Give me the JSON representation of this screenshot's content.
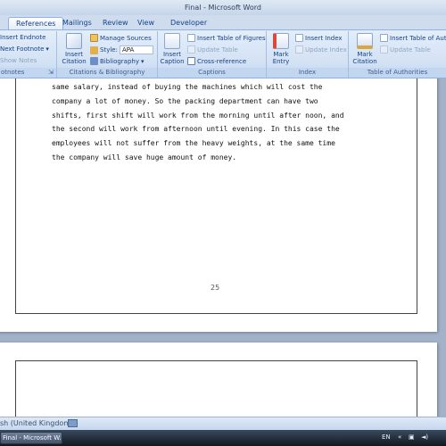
{
  "window": {
    "title": "Final - Microsoft Word"
  },
  "tabs": [
    {
      "label": "References",
      "active": true
    },
    {
      "label": "Mailings"
    },
    {
      "label": "Review"
    },
    {
      "label": "View"
    },
    {
      "label": "Developer"
    }
  ],
  "ribbon": {
    "footnotes": {
      "insert_endnote": "Insert Endnote",
      "next_footnote": "Next Footnote",
      "show_notes": "Show Notes",
      "group_label": "otnotes"
    },
    "citations": {
      "insert_citation": "Insert\nCitation",
      "manage_sources": "Manage Sources",
      "style_label": "Style:",
      "style_value": "APA",
      "bibliography": "Bibliography",
      "group_label": "Citations & Bibliography"
    },
    "captions": {
      "insert_caption": "Insert\nCaption",
      "insert_table_of_figures": "Insert Table of Figures",
      "update_table": "Update Table",
      "cross_reference": "Cross-reference",
      "group_label": "Captions"
    },
    "index": {
      "mark_entry": "Mark\nEntry",
      "insert_index": "Insert Index",
      "update_index": "Update Index",
      "group_label": "Index"
    },
    "authorities": {
      "mark_citation": "Mark\nCitation",
      "insert_table_of_authorities": "Insert Table of Auth",
      "update_table": "Update Table",
      "group_label": "Table of Authorities"
    }
  },
  "document": {
    "lines": [
      "same salary, instead of buying the machines which will cost the",
      "company a lot of money. So the packing department can have two",
      "shifts, first shift will work from the morning until after noon, and",
      "the second will work from afternoon until evening. In this case the",
      "employees will not suffer from the heavy weights, at the same time",
      "the company will save huge amount of money."
    ],
    "page_number": "25"
  },
  "status_bar": {
    "language": "sh (United Kingdom)"
  },
  "taskbar": {
    "active_window": "Final - Microsoft W...",
    "language": "EN"
  },
  "colors": {
    "ribbon_text": "#15428b",
    "disabled_text": "#8fa4bf",
    "doc_background": "#a4b2c8"
  }
}
